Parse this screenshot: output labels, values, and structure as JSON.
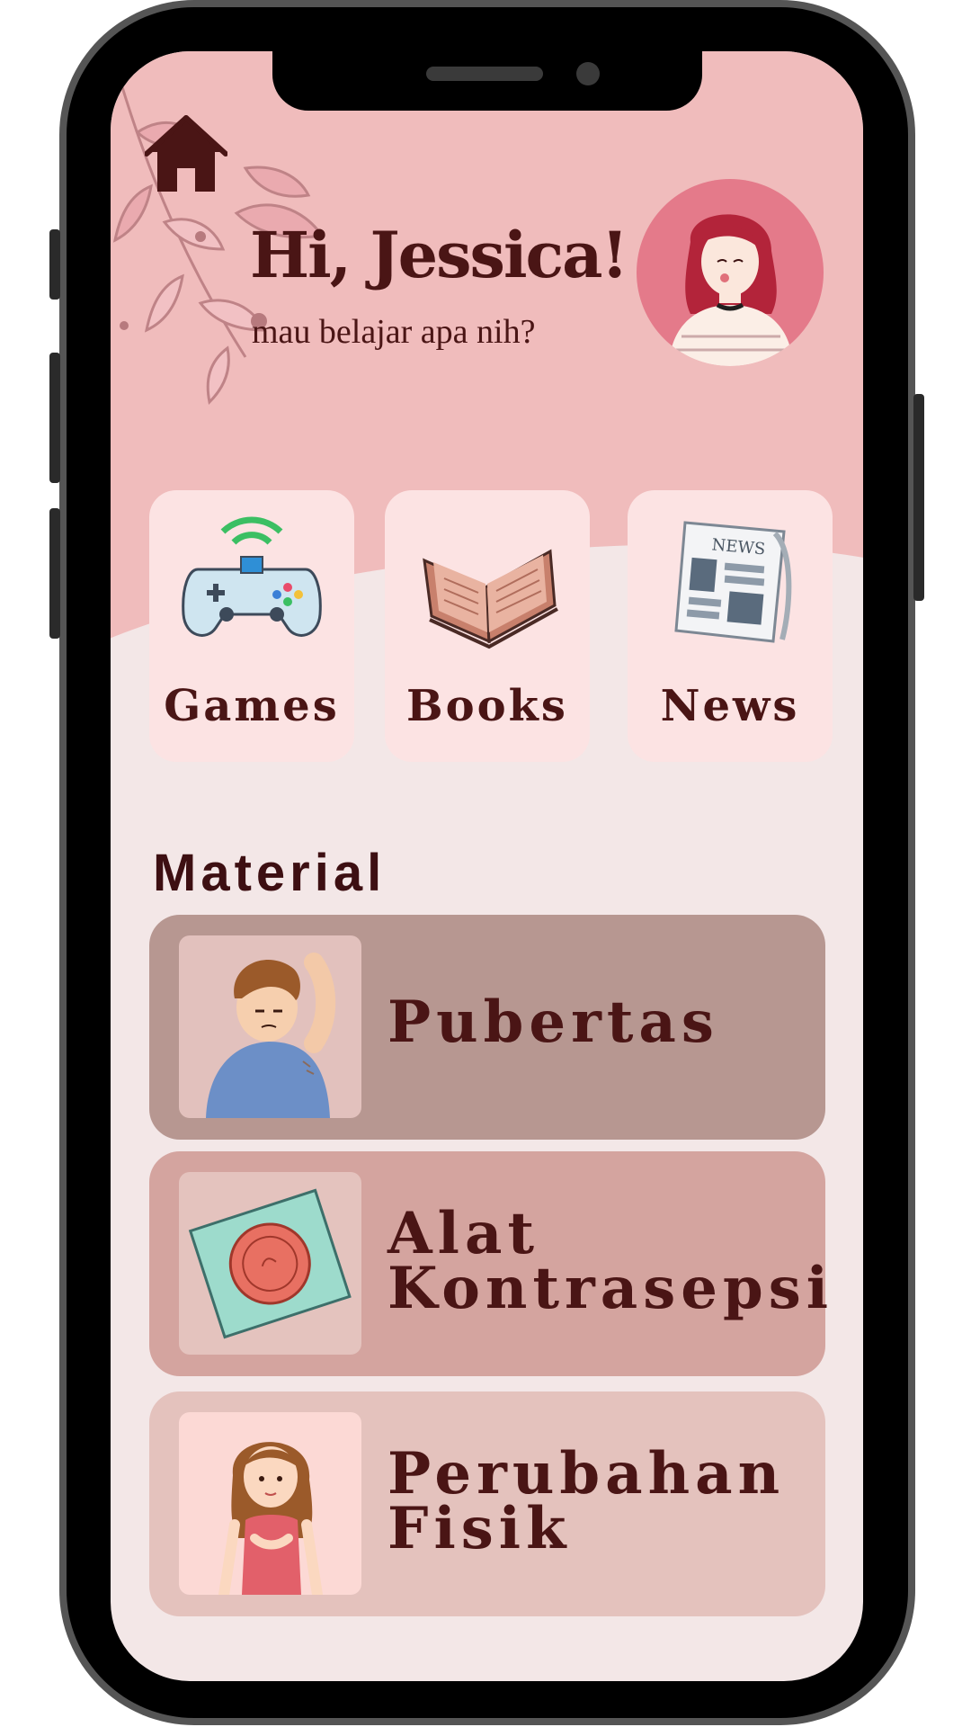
{
  "header": {
    "greeting": "Hi, Jessica!",
    "subtitle": "mau belajar apa nih?"
  },
  "shortcuts": [
    {
      "label": "Games",
      "icon": "gamepad-icon"
    },
    {
      "label": "Books",
      "icon": "book-icon"
    },
    {
      "label": "News",
      "icon": "newspaper-icon"
    }
  ],
  "material": {
    "title": "Material",
    "items": [
      {
        "line1": "Pubertas",
        "line2": ""
      },
      {
        "line1": "Alat",
        "line2": "Kontrasepsi"
      },
      {
        "line1": "Perubahan",
        "line2": "Fisik"
      }
    ]
  },
  "colors": {
    "header_pink": "#f0bcbc",
    "background": "#f3e7e7",
    "text_dark": "#4a1515",
    "card_pubertas": "#b79791",
    "card_kontrasepsi": "#d4a49f",
    "card_perubahan": "#e4c2bd"
  }
}
